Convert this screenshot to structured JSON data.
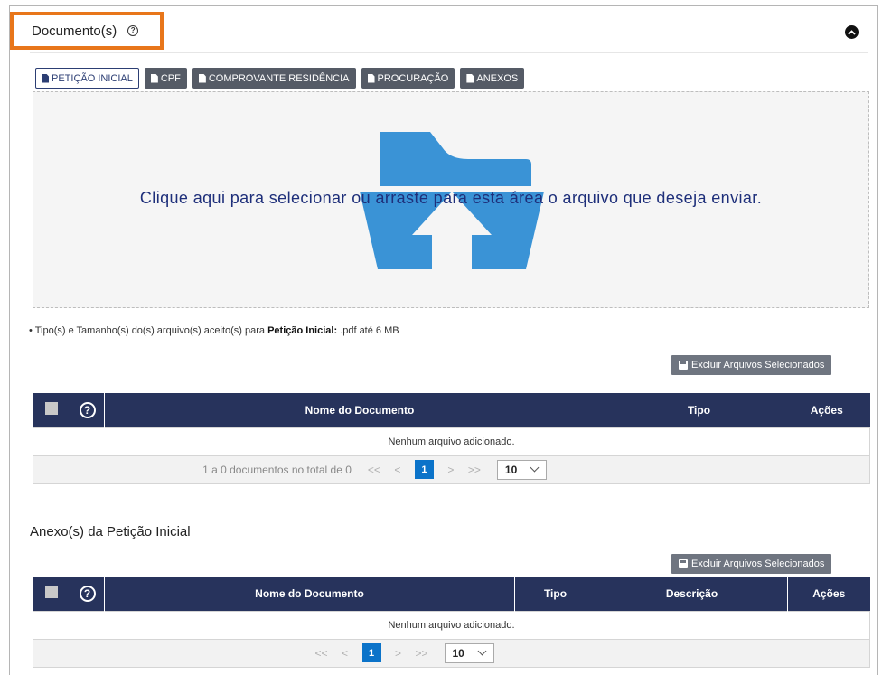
{
  "section": {
    "title": "Documento(s)"
  },
  "tabs": [
    {
      "label": "PETIÇÃO INICIAL",
      "active": true
    },
    {
      "label": "CPF",
      "active": false
    },
    {
      "label": "COMPROVANTE RESIDÊNCIA",
      "active": false
    },
    {
      "label": "PROCURAÇÃO",
      "active": false
    },
    {
      "label": "ANEXOS",
      "active": false
    }
  ],
  "dropzone": {
    "text": "Clique aqui para selecionar ou arraste para esta área o arquivo que deseja enviar."
  },
  "file_info": {
    "prefix": "• Tipo(s) e Tamanho(s) do(s) arquivo(s) aceito(s) para ",
    "doc": "Petição Inicial:",
    "suffix": " .pdf até 6 MB"
  },
  "delete_label": "Excluir Arquivos Selecionados",
  "table1": {
    "headers": {
      "name": "Nome do Documento",
      "type": "Tipo",
      "actions": "Ações"
    },
    "empty": "Nenhum arquivo adicionado.",
    "pager": {
      "summary": "1 a 0 documentos no total de 0",
      "first": "<<",
      "prev": "<",
      "current": "1",
      "next": ">",
      "last": ">>",
      "page_size": "10"
    }
  },
  "annex": {
    "title": "Anexo(s) da Petição Inicial",
    "headers": {
      "name": "Nome do Documento",
      "type": "Tipo",
      "description": "Descrição",
      "actions": "Ações"
    },
    "empty": "Nenhum arquivo adicionado.",
    "pager": {
      "first": "<<",
      "prev": "<",
      "current": "1",
      "next": ">",
      "last": ">>",
      "page_size": "10"
    }
  },
  "colors": {
    "highlight": "#e8761a",
    "table_header": "#27335c",
    "pager_active": "#0b73c9",
    "folder": "#3a93d6"
  }
}
